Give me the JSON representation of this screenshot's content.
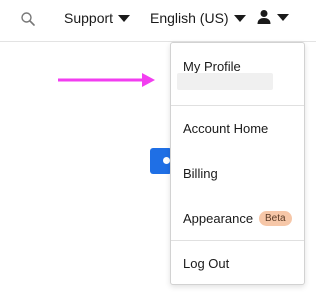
{
  "topbar": {
    "search_icon": "search-icon",
    "support_label": "Support",
    "language_label": "English (US)",
    "account_icon": "user-icon"
  },
  "annotation": {
    "arrow_color": "#f23ef0"
  },
  "menu": {
    "my_profile": "My Profile",
    "account_home": "Account Home",
    "billing": "Billing",
    "appearance": "Appearance",
    "appearance_badge": "Beta",
    "log_out": "Log Out"
  },
  "colors": {
    "primary_button": "#1f6fe5",
    "badge_bg": "#f6c7a8"
  }
}
